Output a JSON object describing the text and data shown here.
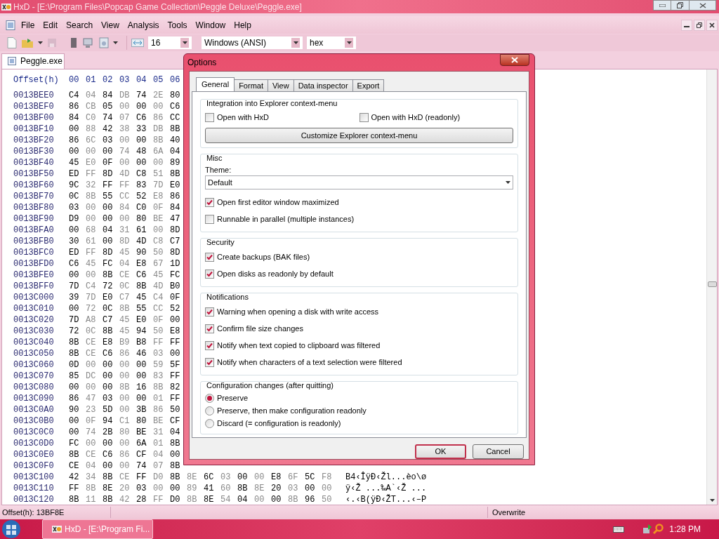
{
  "window": {
    "title": "HxD - [E:\\Program Files\\Popcap Game Collection\\Peggle Deluxe\\Peggle.exe]"
  },
  "menu": [
    "File",
    "Edit",
    "Search",
    "View",
    "Analysis",
    "Tools",
    "Window",
    "Help"
  ],
  "toolbar": {
    "bytes_per_row": "16",
    "charset": "Windows (ANSI)",
    "offset_base": "hex"
  },
  "document_tabs": [
    {
      "label": "Peggle.exe",
      "selected": true
    }
  ],
  "hex_view": {
    "header": {
      "offset": "Offset(h)",
      "columns": [
        "00",
        "01",
        "02",
        "03",
        "04",
        "05",
        "06"
      ]
    },
    "rows": [
      {
        "offset": "0013BEE0",
        "bytes": [
          "C4",
          "04",
          "84",
          "DB",
          "74",
          "2E",
          "80"
        ]
      },
      {
        "offset": "0013BEF0",
        "bytes": [
          "86",
          "CB",
          "05",
          "00",
          "00",
          "00",
          "C6"
        ]
      },
      {
        "offset": "0013BF00",
        "bytes": [
          "84",
          "C0",
          "74",
          "07",
          "C6",
          "86",
          "CC"
        ]
      },
      {
        "offset": "0013BF10",
        "bytes": [
          "00",
          "88",
          "42",
          "38",
          "33",
          "DB",
          "8B"
        ]
      },
      {
        "offset": "0013BF20",
        "bytes": [
          "86",
          "6C",
          "03",
          "00",
          "00",
          "8B",
          "40"
        ]
      },
      {
        "offset": "0013BF30",
        "bytes": [
          "00",
          "00",
          "00",
          "74",
          "48",
          "6A",
          "04"
        ]
      },
      {
        "offset": "0013BF40",
        "bytes": [
          "45",
          "E0",
          "0F",
          "00",
          "00",
          "00",
          "89"
        ]
      },
      {
        "offset": "0013BF50",
        "bytes": [
          "ED",
          "FF",
          "8D",
          "4D",
          "C8",
          "51",
          "8B"
        ]
      },
      {
        "offset": "0013BF60",
        "bytes": [
          "9C",
          "32",
          "FF",
          "FF",
          "83",
          "7D",
          "E0"
        ]
      },
      {
        "offset": "0013BF70",
        "bytes": [
          "0C",
          "8B",
          "55",
          "CC",
          "52",
          "E8",
          "86"
        ]
      },
      {
        "offset": "0013BF80",
        "bytes": [
          "03",
          "00",
          "00",
          "84",
          "C0",
          "0F",
          "84"
        ]
      },
      {
        "offset": "0013BF90",
        "bytes": [
          "D9",
          "00",
          "00",
          "00",
          "80",
          "BE",
          "47"
        ]
      },
      {
        "offset": "0013BFA0",
        "bytes": [
          "00",
          "68",
          "04",
          "31",
          "61",
          "00",
          "8D"
        ]
      },
      {
        "offset": "0013BFB0",
        "bytes": [
          "30",
          "61",
          "00",
          "8D",
          "4D",
          "C8",
          "C7"
        ]
      },
      {
        "offset": "0013BFC0",
        "bytes": [
          "ED",
          "FF",
          "8D",
          "45",
          "90",
          "50",
          "8D"
        ]
      },
      {
        "offset": "0013BFD0",
        "bytes": [
          "C6",
          "45",
          "FC",
          "04",
          "E8",
          "67",
          "1D"
        ]
      },
      {
        "offset": "0013BFE0",
        "bytes": [
          "00",
          "00",
          "8B",
          "CE",
          "C6",
          "45",
          "FC"
        ]
      },
      {
        "offset": "0013BFF0",
        "bytes": [
          "7D",
          "C4",
          "72",
          "0C",
          "8B",
          "4D",
          "B0"
        ]
      },
      {
        "offset": "0013C000",
        "bytes": [
          "39",
          "7D",
          "E0",
          "C7",
          "45",
          "C4",
          "0F"
        ]
      },
      {
        "offset": "0013C010",
        "bytes": [
          "00",
          "72",
          "0C",
          "8B",
          "55",
          "CC",
          "52"
        ]
      },
      {
        "offset": "0013C020",
        "bytes": [
          "7D",
          "A8",
          "C7",
          "45",
          "E0",
          "0F",
          "00"
        ]
      },
      {
        "offset": "0013C030",
        "bytes": [
          "72",
          "0C",
          "8B",
          "45",
          "94",
          "50",
          "E8"
        ]
      },
      {
        "offset": "0013C040",
        "bytes": [
          "8B",
          "CE",
          "E8",
          "B9",
          "B8",
          "FF",
          "FF"
        ]
      },
      {
        "offset": "0013C050",
        "bytes": [
          "8B",
          "CE",
          "C6",
          "86",
          "46",
          "03",
          "00"
        ]
      },
      {
        "offset": "0013C060",
        "bytes": [
          "0D",
          "00",
          "00",
          "00",
          "00",
          "59",
          "5F"
        ]
      },
      {
        "offset": "0013C070",
        "bytes": [
          "85",
          "DC",
          "00",
          "00",
          "00",
          "83",
          "FF"
        ]
      },
      {
        "offset": "0013C080",
        "bytes": [
          "00",
          "00",
          "00",
          "8B",
          "16",
          "8B",
          "82"
        ]
      },
      {
        "offset": "0013C090",
        "bytes": [
          "86",
          "47",
          "03",
          "00",
          "00",
          "01",
          "FF"
        ]
      },
      {
        "offset": "0013C0A0",
        "bytes": [
          "90",
          "23",
          "5D",
          "00",
          "3B",
          "86",
          "50"
        ]
      },
      {
        "offset": "0013C0B0",
        "bytes": [
          "00",
          "0F",
          "94",
          "C1",
          "80",
          "BE",
          "CF"
        ]
      },
      {
        "offset": "0013C0C0",
        "bytes": [
          "00",
          "74",
          "2B",
          "80",
          "BE",
          "31",
          "04"
        ]
      },
      {
        "offset": "0013C0D0",
        "bytes": [
          "FC",
          "00",
          "00",
          "00",
          "6A",
          "01",
          "8B"
        ]
      },
      {
        "offset": "0013C0E0",
        "bytes": [
          "8B",
          "CE",
          "C6",
          "86",
          "CF",
          "04",
          "00"
        ]
      },
      {
        "offset": "0013C0F0",
        "bytes": [
          "CE",
          "04",
          "00",
          "00",
          "74",
          "07",
          "8B"
        ]
      },
      {
        "offset": "0013C100",
        "bytes": [
          "42",
          "34",
          "8B",
          "CE",
          "FF",
          "D0",
          "8B",
          "8E",
          "6C",
          "03",
          "00",
          "00",
          "E8",
          "6F",
          "5C",
          "F8"
        ],
        "text": "B4‹ÎÿÐ‹Žl...èo\\ø"
      },
      {
        "offset": "0013C110",
        "bytes": [
          "FF",
          "8B",
          "8E",
          "20",
          "03",
          "00",
          "00",
          "89",
          "41",
          "60",
          "8B",
          "8E",
          "20",
          "03",
          "00",
          "00"
        ],
        "text": "ÿ‹Ž ...‰A`‹Ž ..."
      },
      {
        "offset": "0013C120",
        "bytes": [
          "8B",
          "11",
          "8B",
          "42",
          "28",
          "FF",
          "D0",
          "8B",
          "8E",
          "54",
          "04",
          "00",
          "00",
          "8B",
          "96",
          "50"
        ],
        "text": "‹.‹B(ÿÐ‹ŽT...‹–P"
      }
    ]
  },
  "dialog": {
    "title": "Options",
    "tabs": [
      {
        "label": "General",
        "selected": true
      },
      {
        "label": "Format",
        "selected": false
      },
      {
        "label": "View",
        "selected": false
      },
      {
        "label": "Data inspector",
        "selected": false
      },
      {
        "label": "Export",
        "selected": false
      }
    ],
    "groups": [
      {
        "title": "Integration into Explorer context-menu",
        "items": [
          {
            "kind": "checkbox_row",
            "items": [
              {
                "label": "Open with HxD",
                "checked": false
              },
              {
                "label": "Open with HxD (readonly)",
                "checked": false
              }
            ]
          },
          {
            "kind": "button",
            "label": "Customize Explorer context-menu"
          }
        ]
      },
      {
        "title": "Misc",
        "items": [
          {
            "kind": "label",
            "label": "Theme:"
          },
          {
            "kind": "dropdown",
            "value": "Default"
          },
          {
            "kind": "checkbox",
            "label": "Open first editor window maximized",
            "checked": true
          },
          {
            "kind": "checkbox",
            "label": "Runnable in parallel (multiple instances)",
            "checked": false
          }
        ]
      },
      {
        "title": "Security",
        "items": [
          {
            "kind": "checkbox",
            "label": "Create backups (BAK files)",
            "checked": true
          },
          {
            "kind": "checkbox",
            "label": "Open disks as readonly by default",
            "checked": true
          }
        ]
      },
      {
        "title": "Notifications",
        "items": [
          {
            "kind": "checkbox",
            "label": "Warning when opening a disk with write access",
            "checked": true
          },
          {
            "kind": "checkbox",
            "label": "Confirm file size changes",
            "checked": true
          },
          {
            "kind": "checkbox",
            "label": "Notify when text copied to clipboard was filtered",
            "checked": true
          },
          {
            "kind": "checkbox",
            "label": "Notify when characters of a text selection were filtered",
            "checked": true
          }
        ]
      },
      {
        "title": "Configuration changes (after quitting)",
        "items": [
          {
            "kind": "radio",
            "label": "Preserve",
            "selected": true
          },
          {
            "kind": "radio",
            "label": "Preserve, then make configuration readonly",
            "selected": false
          },
          {
            "kind": "radio",
            "label": "Discard (= configuration is readonly)",
            "selected": false
          }
        ]
      }
    ],
    "buttons": [
      {
        "label": "OK",
        "default": true
      },
      {
        "label": "Cancel",
        "default": false
      }
    ]
  },
  "status_bar": {
    "offset": "Offset(h): 13BF8E",
    "mode": "Overwrite"
  },
  "taskbar": {
    "tasks": [
      {
        "label": "HxD - [E:\\Program Fi..."
      }
    ],
    "clock": "1:28 PM"
  }
}
